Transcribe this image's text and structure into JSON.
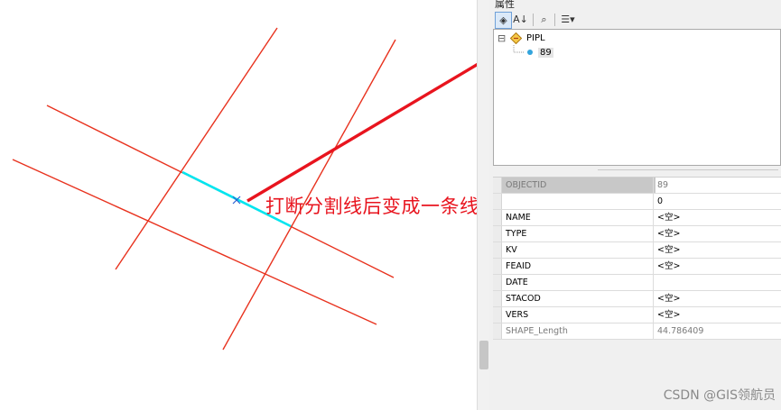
{
  "annotation": {
    "text": "打断分割线后变成一条线"
  },
  "panel": {
    "title": "属性",
    "toolbar": [
      {
        "name": "identify-tool",
        "glyph": "◈",
        "active": true
      },
      {
        "name": "sort-tool",
        "glyph": "A↓"
      },
      {
        "name": "find-tool",
        "glyph": "⌕"
      },
      {
        "name": "options-tool",
        "glyph": "☰▾"
      }
    ],
    "tree": {
      "layer": "PIPL",
      "feature": "89",
      "expand_glyph": "⊟"
    },
    "fields": [
      {
        "name": "OBJECTID",
        "value": "89",
        "readonly": true
      },
      {
        "name": "",
        "value": "0",
        "readonly": false
      },
      {
        "name": "NAME",
        "value": "<空>",
        "readonly": false
      },
      {
        "name": "TYPE",
        "value": "<空>",
        "readonly": false
      },
      {
        "name": "KV",
        "value": "<空>",
        "readonly": false
      },
      {
        "name": "FEAID",
        "value": "<空>",
        "readonly": false
      },
      {
        "name": "DATE",
        "value": "",
        "readonly": false
      },
      {
        "name": "STACOD",
        "value": "<空>",
        "readonly": false
      },
      {
        "name": "VERS",
        "value": "<空>",
        "readonly": false
      },
      {
        "name": "SHAPE_Length",
        "value": "44.786409",
        "readonly": true
      }
    ]
  },
  "watermark": "CSDN @GIS领航员",
  "colors": {
    "line": "#e8321e",
    "highlight": "#00e5ef",
    "arrow": "#e8141e",
    "header": "#c8c8c8"
  }
}
